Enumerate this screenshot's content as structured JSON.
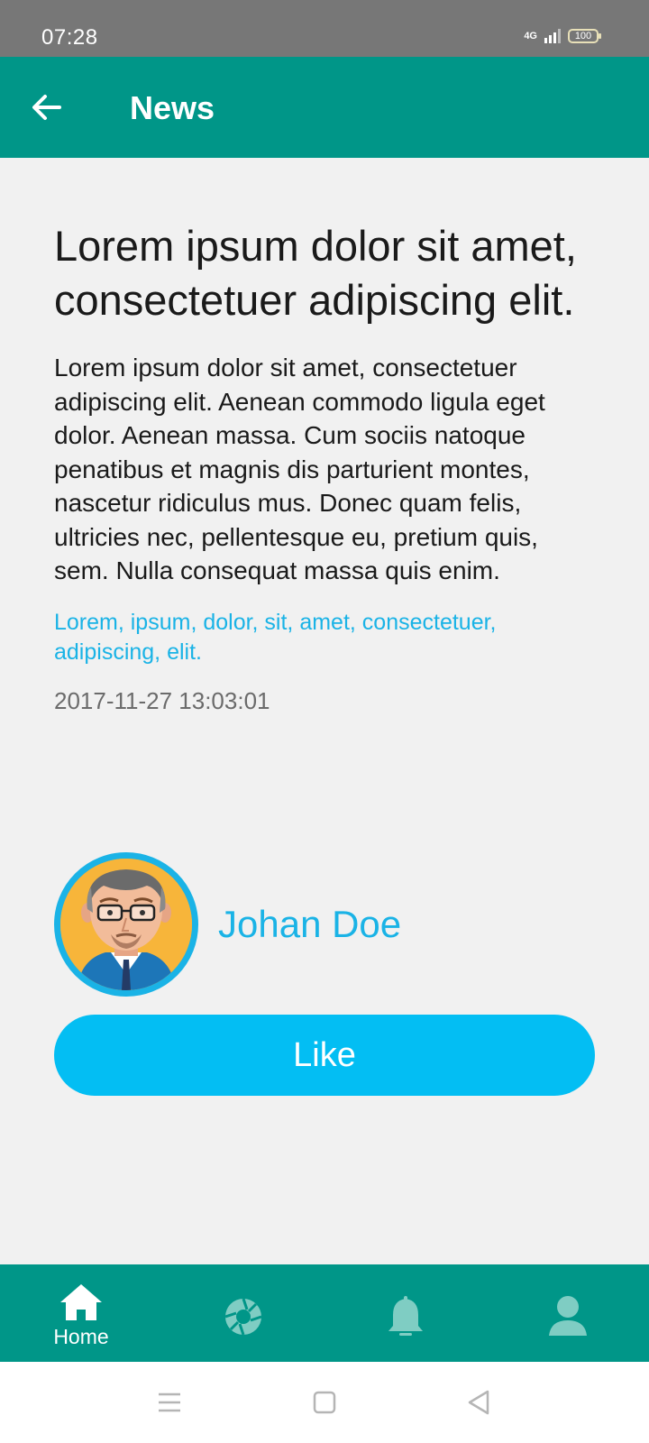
{
  "status_bar": {
    "time": "07:28",
    "network": "4G",
    "battery": "100"
  },
  "app_bar": {
    "title": "News",
    "back_icon": "arrow-left-icon"
  },
  "article": {
    "title": "Lorem ipsum dolor sit amet, consectetuer adipiscing elit.",
    "body": "Lorem ipsum dolor sit amet, consectetuer adipiscing elit. Aenean commodo ligula eget dolor. Aenean massa. Cum sociis natoque penatibus et magnis dis parturient montes, nascetur ridiculus mus. Donec quam felis, ultricies nec, pellentesque eu, pretium quis, sem. Nulla consequat massa quis enim.",
    "tags": "Lorem, ipsum, dolor, sit, amet, consectetuer, adipiscing, elit.",
    "timestamp": "2017-11-27 13:03:01",
    "author": "Johan Doe",
    "like_label": "Like"
  },
  "bottom_nav": {
    "items": [
      {
        "label": "Home",
        "icon": "home-icon",
        "active": true
      },
      {
        "label": "",
        "icon": "aperture-icon",
        "active": false
      },
      {
        "label": "",
        "icon": "bell-icon",
        "active": false
      },
      {
        "label": "",
        "icon": "user-icon",
        "active": false
      }
    ]
  },
  "system_nav": {
    "icons": [
      "menu-icon",
      "square-icon",
      "back-triangle-icon"
    ]
  },
  "colors": {
    "primary": "#009688",
    "accent": "#03bef3",
    "link": "#1ab3e6",
    "status_bar": "#777777",
    "background": "#f1f1f1"
  }
}
